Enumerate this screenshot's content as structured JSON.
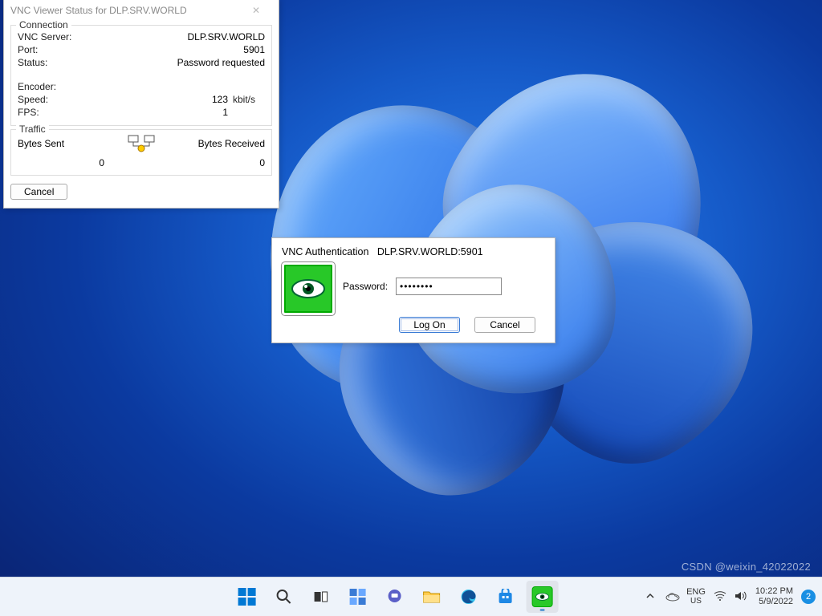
{
  "status_window": {
    "title": "VNC Viewer Status for DLP.SRV.WORLD",
    "connection": {
      "legend": "Connection",
      "server_label": "VNC Server:",
      "server_value": "DLP.SRV.WORLD",
      "port_label": "Port:",
      "port_value": "5901",
      "status_label": "Status:",
      "status_value": "Password requested",
      "encoder_label": "Encoder:",
      "encoder_value": "",
      "speed_label": "Speed:",
      "speed_value": "123",
      "speed_unit": "kbit/s",
      "fps_label": "FPS:",
      "fps_value": "1"
    },
    "traffic": {
      "legend": "Traffic",
      "sent_label": "Bytes Sent",
      "sent_value": "0",
      "recv_label": "Bytes Received",
      "recv_value": "0"
    },
    "cancel": "Cancel"
  },
  "auth_dialog": {
    "title_prefix": "VNC Authentication",
    "host": "DLP.SRV.WORLD:5901",
    "password_label": "Password:",
    "password_value": "••••••••",
    "logon": "Log On",
    "cancel": "Cancel"
  },
  "taskbar": {
    "lang": "ENG",
    "kb_layout": "US",
    "time": "10:22 PM",
    "date": "5/9/2022",
    "notif_count": "2"
  },
  "watermark": "CSDN @weixin_42022022"
}
